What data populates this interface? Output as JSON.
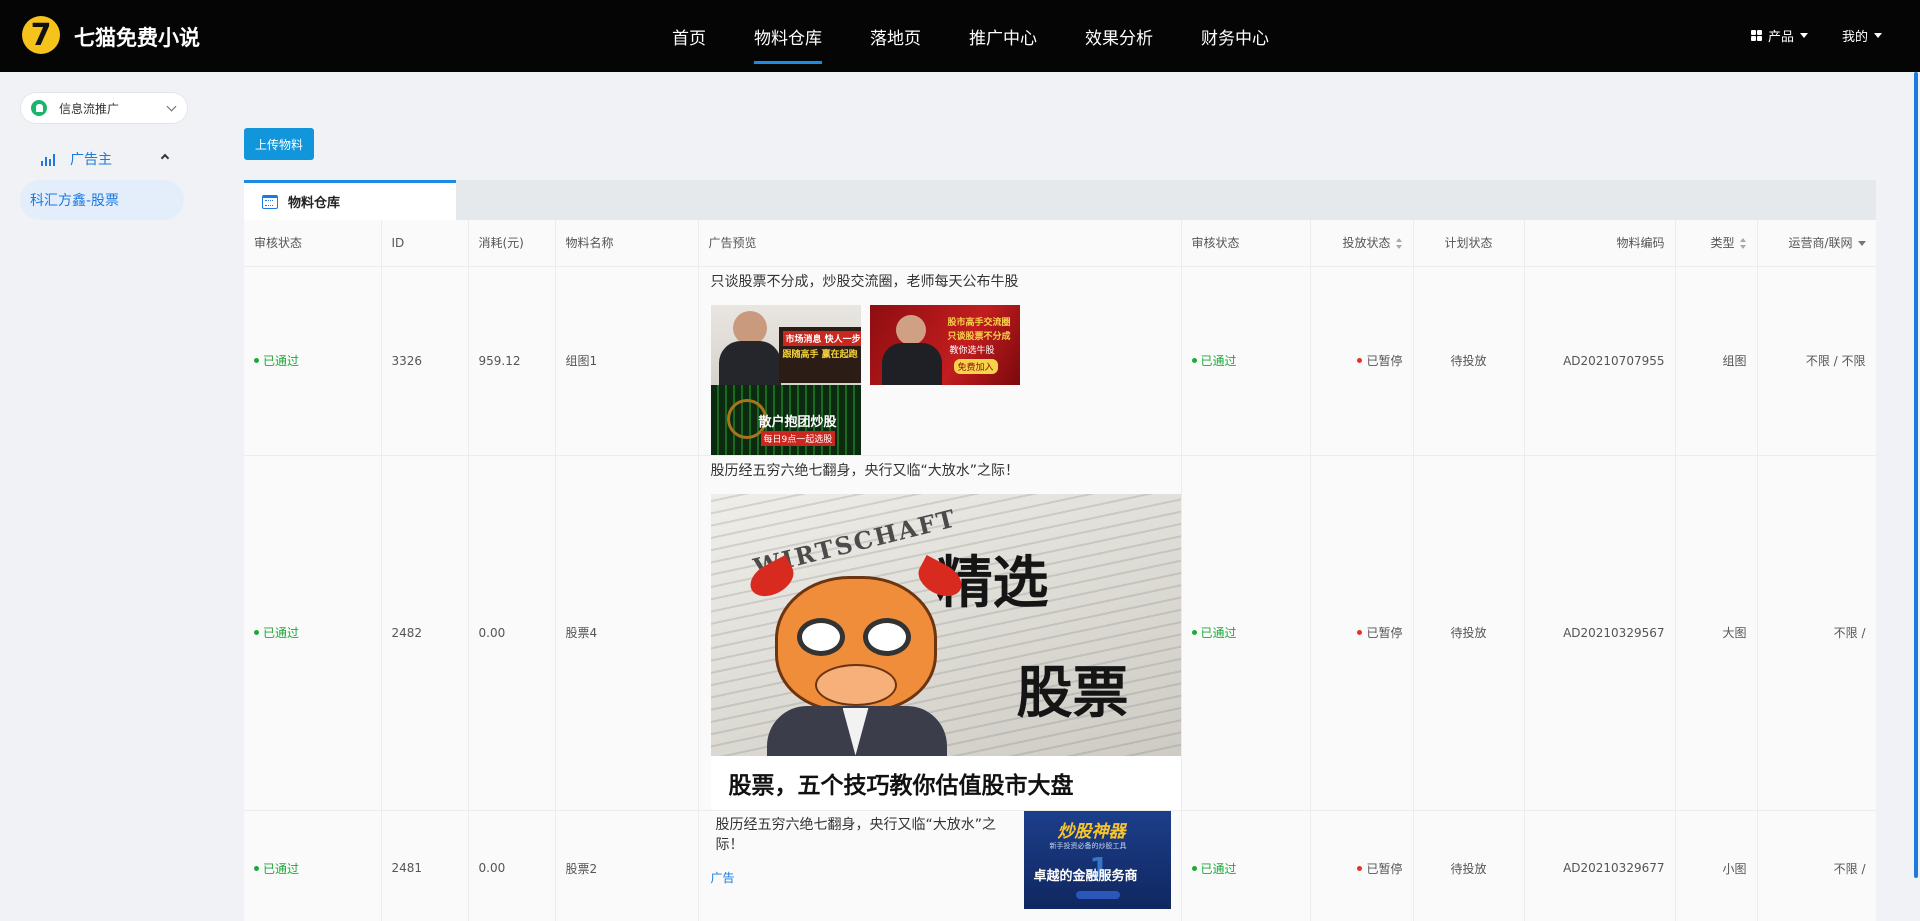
{
  "app": {
    "brand": "七猫免费小说",
    "logo_icon": "seven-cat-logo"
  },
  "nav": {
    "items": [
      "首页",
      "物料仓库",
      "落地页",
      "推广中心",
      "效果分析",
      "财务中心"
    ],
    "active": "物料仓库"
  },
  "topright": {
    "product_label": "产品",
    "mine_label": "我的"
  },
  "sidebar": {
    "select_value": "信息流推广",
    "group_label": "广告主",
    "sub_item": "科汇方鑫-股票"
  },
  "toolbar": {
    "upload_label": "上传物料"
  },
  "tab": {
    "label": "物料仓库"
  },
  "table": {
    "headers": [
      "审核状态",
      "ID",
      "消耗(元)",
      "物料名称",
      "广告预览",
      "审核状态",
      "投放状态",
      "计划状态",
      "物料编码",
      "类型",
      "运营商/联网"
    ],
    "rows": [
      {
        "review": "已通过",
        "id": "3326",
        "cost": "959.12",
        "name": "组图1",
        "preview_title": "只谈股票不分成，炒股交流圈，老师每天公布牛股",
        "img1_a": "市场消息 快人一步",
        "img1_b": "跟随高手 赢在起跑",
        "img1_c": "散户抱团炒股",
        "img1_d": "每日9点一起选股",
        "img2_a": "股市高手交流圈",
        "img2_b": "只谈股票不分成",
        "img2_c": "教你选牛股",
        "img2_d": "免费加入",
        "review2": "已通过",
        "delivery": "已暂停",
        "plan": "待投放",
        "code": "AD20210707955",
        "type": "组图",
        "network": "不限 / 不限"
      },
      {
        "review": "已通过",
        "id": "2482",
        "cost": "0.00",
        "name": "股票4",
        "preview_title": "股历经五穷六绝七翻身，央行又临“大放水”之际！",
        "img_paper": "WIRTSCHAFT",
        "img_big1": "精选",
        "img_big2": "股票",
        "img_caption": "股票，五个技巧教你估值股市大盘",
        "review2": "已通过",
        "delivery": "已暂停",
        "plan": "待投放",
        "code": "AD20210329567",
        "type": "大图",
        "network": "不限 /"
      },
      {
        "review": "已通过",
        "id": "2481",
        "cost": "0.00",
        "name": "股票2",
        "preview_title": "股历经五穷六绝七翻身，央行又临“大放水”之际！",
        "ad_tag": "广告",
        "img_logo": "炒股神器",
        "img_sub": "新手投资必备的炒股工具",
        "img_slogan": "卓越的金融服务商",
        "review2": "已通过",
        "delivery": "已暂停",
        "plan": "待投放",
        "code": "AD20210329677",
        "type": "小图",
        "network": "不限 /"
      }
    ]
  },
  "colors": {
    "accent": "#1d7ae0",
    "approved": "#1fa83a",
    "paused": "#e5322d",
    "topbar": "#050505"
  }
}
